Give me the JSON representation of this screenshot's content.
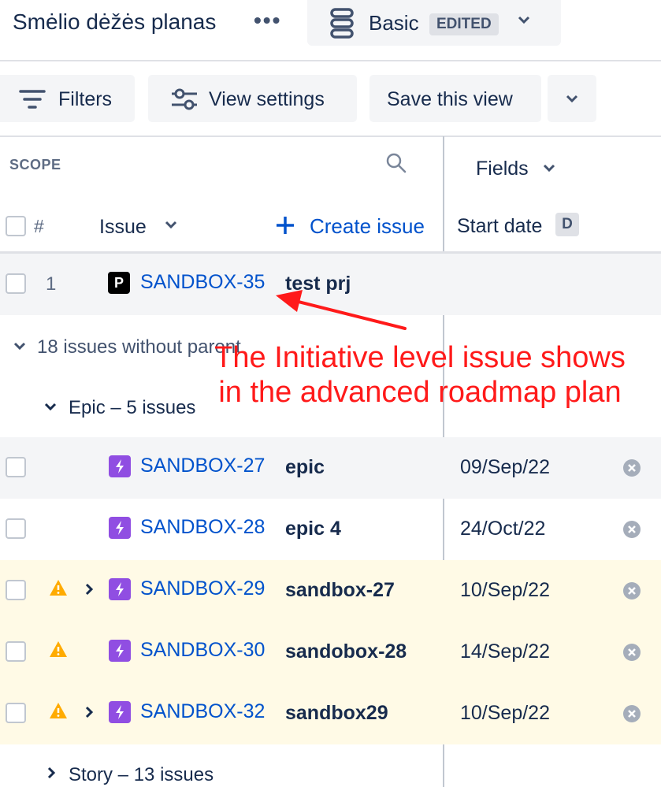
{
  "header": {
    "plan_title": "Smėlio dėžės planas",
    "more_label": "•••",
    "view_name": "Basic",
    "view_badge": "EDITED"
  },
  "toolbar": {
    "filters_label": "Filters",
    "view_settings_label": "View settings",
    "save_view_label": "Save this view"
  },
  "scope": {
    "label": "SCOPE",
    "fields_label": "Fields"
  },
  "columns": {
    "number": "#",
    "issue": "Issue",
    "create_issue": "Create issue",
    "start_date": "Start date",
    "start_date_badge": "D"
  },
  "rows": [
    {
      "num": "1",
      "key": "SANDBOX-35",
      "summary": "test prj",
      "type_letter": "P",
      "start_date": ""
    }
  ],
  "groups": {
    "without_parent": "18 issues without parent",
    "epic": "Epic – 5 issues",
    "story": "Story – 13 issues"
  },
  "epics": [
    {
      "key": "SANDBOX-27",
      "summary": "epic",
      "start_date": "09/Sep/22"
    },
    {
      "key": "SANDBOX-28",
      "summary": "epic 4",
      "start_date": "24/Oct/22"
    },
    {
      "key": "SANDBOX-29",
      "summary": "sandbox-27",
      "start_date": "10/Sep/22"
    },
    {
      "key": "SANDBOX-30",
      "summary": "sandobox-28",
      "start_date": "14/Sep/22"
    },
    {
      "key": "SANDBOX-32",
      "summary": "sandbox29",
      "start_date": "10/Sep/22"
    }
  ],
  "annotation": {
    "line1": "The Initiative level issue shows",
    "line2": "in the advanced roadmap plan"
  },
  "colors": {
    "link": "#0052cc",
    "epic": "#904ee2",
    "warning": "#ffab00",
    "annotation": "#ff1a1a"
  }
}
